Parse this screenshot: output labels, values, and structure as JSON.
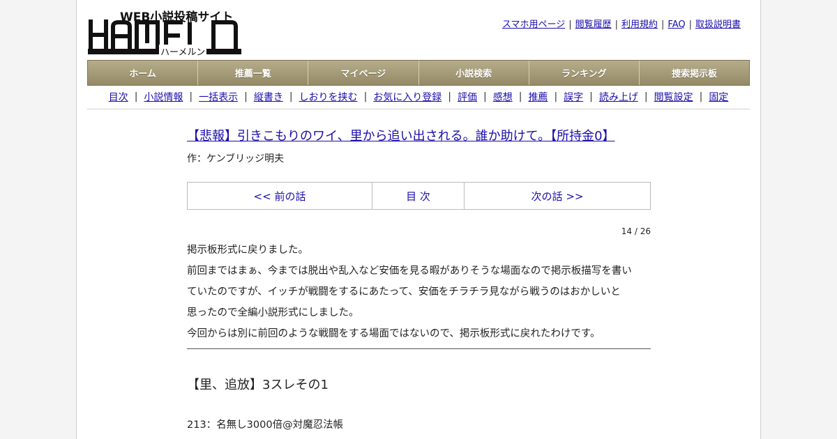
{
  "logo": {
    "tagline": "WEB小説投稿サイト",
    "wordmark": "HAMELN",
    "kana": "ハーメルン"
  },
  "toplinks": [
    "スマホ用ページ",
    "閲覧履歴",
    "利用規約",
    "FAQ",
    "取扱説明書"
  ],
  "mainnav": [
    "ホーム",
    "推薦一覧",
    "マイページ",
    "小説検索",
    "ランキング",
    "捜索掲示板"
  ],
  "subnav": [
    "目次",
    "小説情報",
    "一括表示",
    "縦書き",
    "しおりを挟む",
    "お気に入り登録",
    "評価",
    "感想",
    "推薦",
    "誤字",
    "読み上げ",
    "閲覧設定",
    "固定"
  ],
  "novel": {
    "title": "【悲報】引きこもりのワイ、里から追い出される。誰か助けて。【所持金0】",
    "author": "作：ケンブリッジ明夫"
  },
  "chapnav": {
    "prev": "<< 前の話",
    "toc": "目 次",
    "next": "次の話 >>"
  },
  "pagecount": "14 / 26",
  "preface": [
    "掲示板形式に戻りました。",
    "前回まではまぁ、今までは脱出や乱入など安価を見る暇がありそうな場面なので掲示板描写を書い",
    "ていたのですが、イッチが戦闘をするにあたって、安価をチラチラ見ながら戦うのはおかしいと",
    "思ったので全編小説形式にしました。",
    "今回からは別に前回のような戦闘をする場面ではないので、掲示板形式に戻れたわけです。"
  ],
  "chapter_title": "【里、追放】3スレその1",
  "body": [
    "213：名無し3000倍@対魔忍法帳"
  ],
  "colors": {
    "link": "#1a0dab",
    "nav_bg": "#a69d7a"
  }
}
